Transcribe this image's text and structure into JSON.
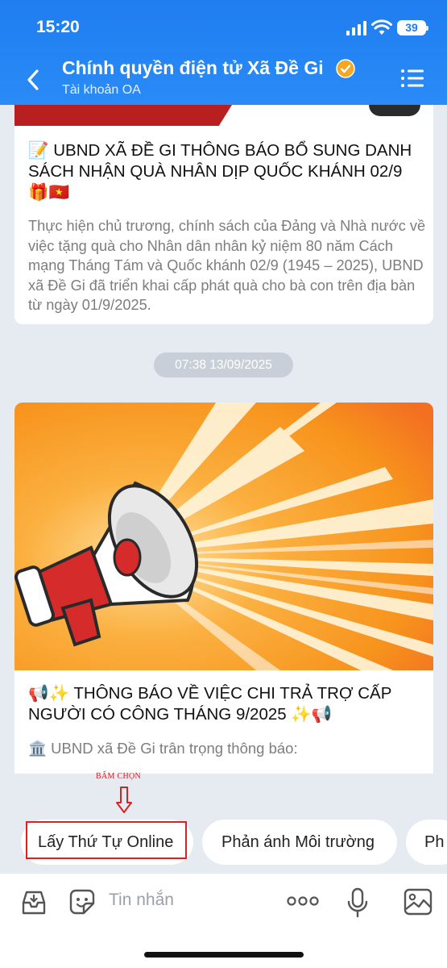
{
  "status_bar": {
    "time": "15:20",
    "battery": "39"
  },
  "header": {
    "title": "Chính quyền điện tử Xã Đề Gi",
    "subtitle": "Tài khoản OA"
  },
  "posts": [
    {
      "title": "📝 UBND XÃ ĐỀ GI THÔNG BÁO BỔ SUNG DANH SÁCH NHẬN QUÀ NHÂN DỊP QUỐC KHÁNH 02/9 🎁🇻🇳",
      "body": "Thực hiện chủ trương, chính sách của Đảng và Nhà nước về việc tặng quà cho Nhân dân nhân kỷ niệm 80 năm Cách mạng Tháng Tám và Quốc khánh 02/9 (1945 – 2025), UBND xã Đề Gi đã triển khai cấp phát quà cho bà con trên địa bàn từ ngày 01/9/2025."
    },
    {
      "title": "📢✨ THÔNG BÁO VỀ VIỆC CHI TRẢ TRỢ CẤP NGƯỜI CÓ CÔNG THÁNG 9/2025 ✨📢",
      "body": "🏛️ UBND xã Đề Gi trân trọng thông báo:"
    }
  ],
  "timestamp": "07:38 13/09/2025",
  "annotation": {
    "label": "BẤM CHỌN"
  },
  "quick_replies": [
    "Lấy Thứ Tự Online",
    "Phản ánh Môi trường",
    "Ph"
  ],
  "input": {
    "placeholder": "Tin nhắn"
  },
  "colors": {
    "header_blue": "#1f7df0",
    "annotation_red": "#d92222",
    "background": "#e6eaf1"
  }
}
